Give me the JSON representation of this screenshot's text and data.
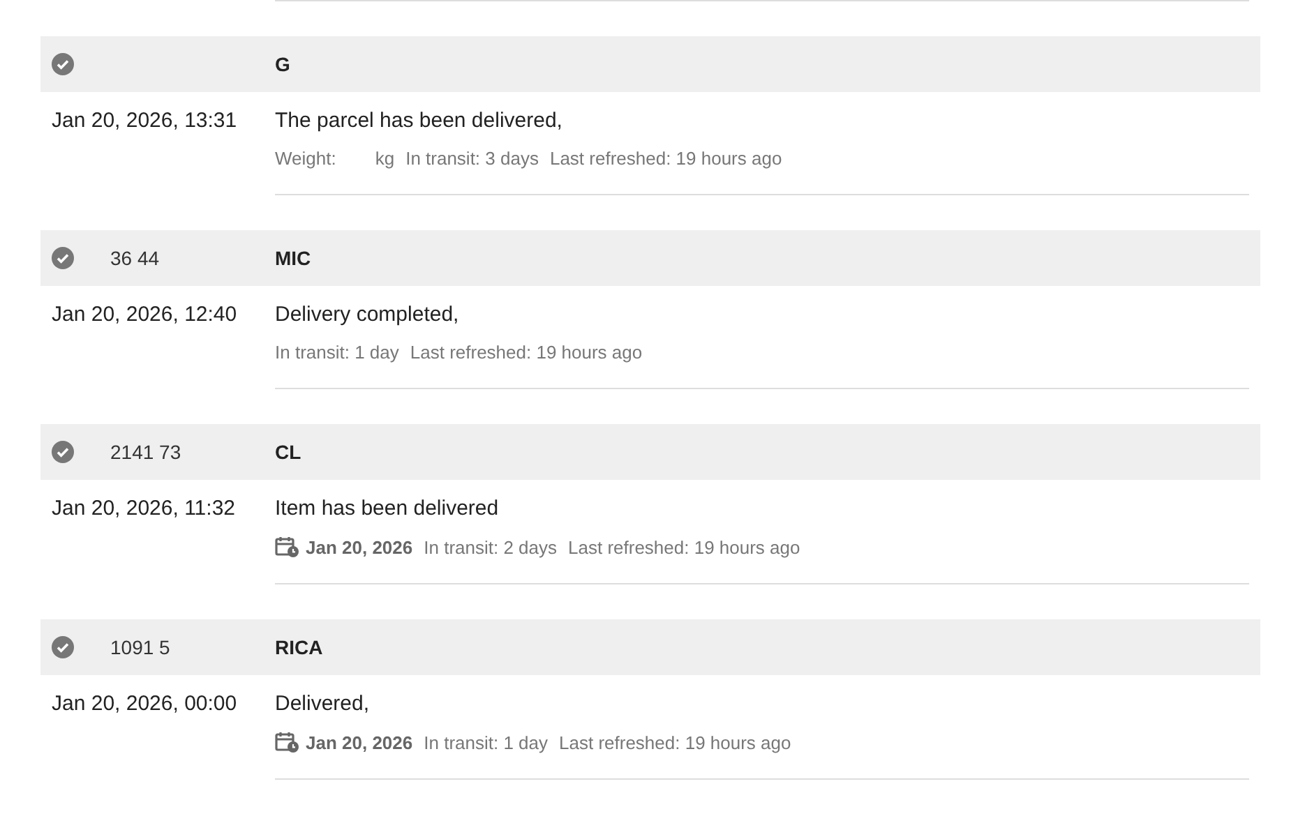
{
  "shipments": [
    {
      "recipient": "G",
      "delivered": true,
      "time": "Jan 20, 2026, 13:31",
      "message": "The parcel has been delivered,",
      "meta": [
        {
          "kind": "weight",
          "label": "Weight:",
          "unit": "kg"
        },
        {
          "kind": "text",
          "text": "In transit: 3 days"
        },
        {
          "kind": "text",
          "text": "Last refreshed: 19 hours ago"
        }
      ]
    },
    {
      "tracking": "36 44",
      "recipient": "MIC",
      "delivered": true,
      "time": "Jan 20, 2026, 12:40",
      "message": "Delivery completed,",
      "meta": [
        {
          "kind": "text",
          "text": "In transit: 1 day"
        },
        {
          "kind": "text",
          "text": "Last refreshed: 19 hours ago"
        }
      ]
    },
    {
      "tracking": "2141 73",
      "recipient": "CL",
      "delivered": true,
      "time": "Jan 20, 2026, 11:32",
      "message": "Item has been delivered",
      "meta": [
        {
          "kind": "date",
          "text": "Jan 20, 2026"
        },
        {
          "kind": "text",
          "text": "In transit: 2 days"
        },
        {
          "kind": "text",
          "text": "Last refreshed: 19 hours ago"
        }
      ]
    },
    {
      "tracking": "1091 5",
      "recipient": "RICA",
      "delivered": true,
      "time": "Jan 20, 2026, 00:00",
      "message": "Delivered,",
      "meta": [
        {
          "kind": "date",
          "text": "Jan 20, 2026"
        },
        {
          "kind": "text",
          "text": "In transit: 1 day"
        },
        {
          "kind": "text",
          "text": "Last refreshed: 19 hours ago"
        }
      ]
    }
  ]
}
